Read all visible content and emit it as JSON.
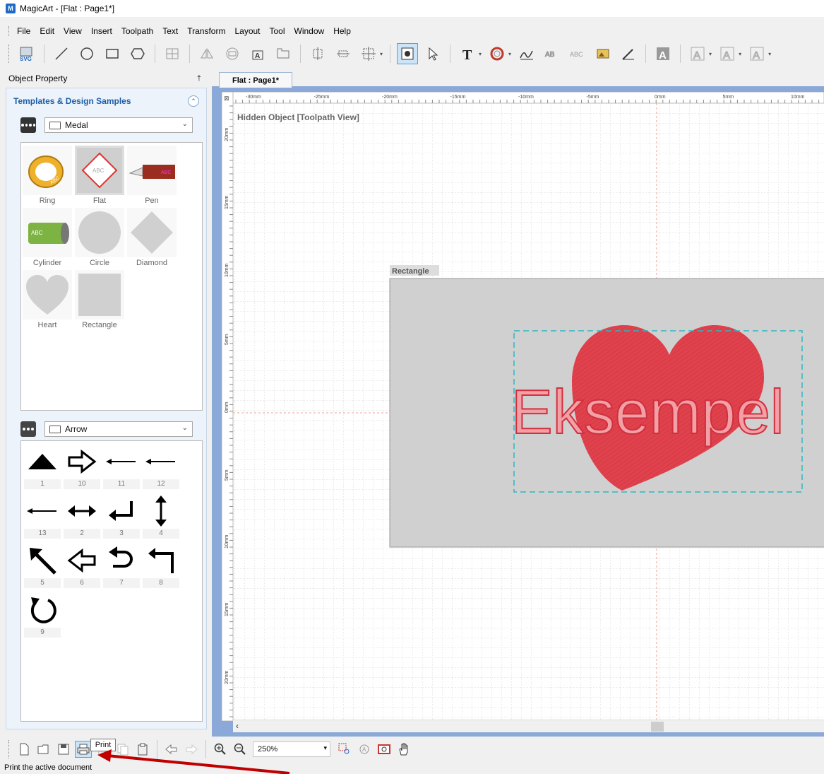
{
  "window": {
    "title": "MagicArt - [Flat : Page1*]"
  },
  "menu": [
    "File",
    "Edit",
    "View",
    "Insert",
    "Toolpath",
    "Text",
    "Transform",
    "Layout",
    "Tool",
    "Window",
    "Help"
  ],
  "toolbar": {
    "svg_label": "SVG"
  },
  "panel": {
    "header": "Object Property",
    "pin": "†",
    "templates_title": "Templates & Design Samples",
    "template_category": "Medal",
    "templates": [
      "Ring",
      "Flat",
      "Pen",
      "Cylinder",
      "Circle",
      "Diamond",
      "Heart",
      "Rectangle"
    ],
    "template_sample_text": "ABC",
    "arrow_category": "Arrow",
    "arrows": [
      "1",
      "10",
      "11",
      "12",
      "13",
      "2",
      "3",
      "4",
      "5",
      "6",
      "7",
      "8",
      "9"
    ]
  },
  "document": {
    "tab": "Flat : Page1*",
    "hidden_label": "Hidden Object [Toolpath View]",
    "rect_label": "Rectangle",
    "text": "Eksempel",
    "ruler_top": [
      "-30mm",
      "-25mm",
      "-20mm",
      "-15mm",
      "-10mm",
      "-5mm",
      "0mm",
      "5mm",
      "10mm"
    ],
    "ruler_left": [
      "20mm",
      "15mm",
      "10mm",
      "5mm",
      "0mm",
      "5mm",
      "10mm",
      "15mm",
      "20mm"
    ]
  },
  "bottom": {
    "zoom": "250%",
    "tooltip": "Print",
    "status": "Print the active document"
  },
  "colors": {
    "accent": "#1d5ea8",
    "heart": "#e0424d",
    "text_stroke": "#e0424d",
    "rect_fill": "#d0d0d0",
    "selection": "#2ab7c4",
    "arrow_annotation": "#c00000"
  }
}
